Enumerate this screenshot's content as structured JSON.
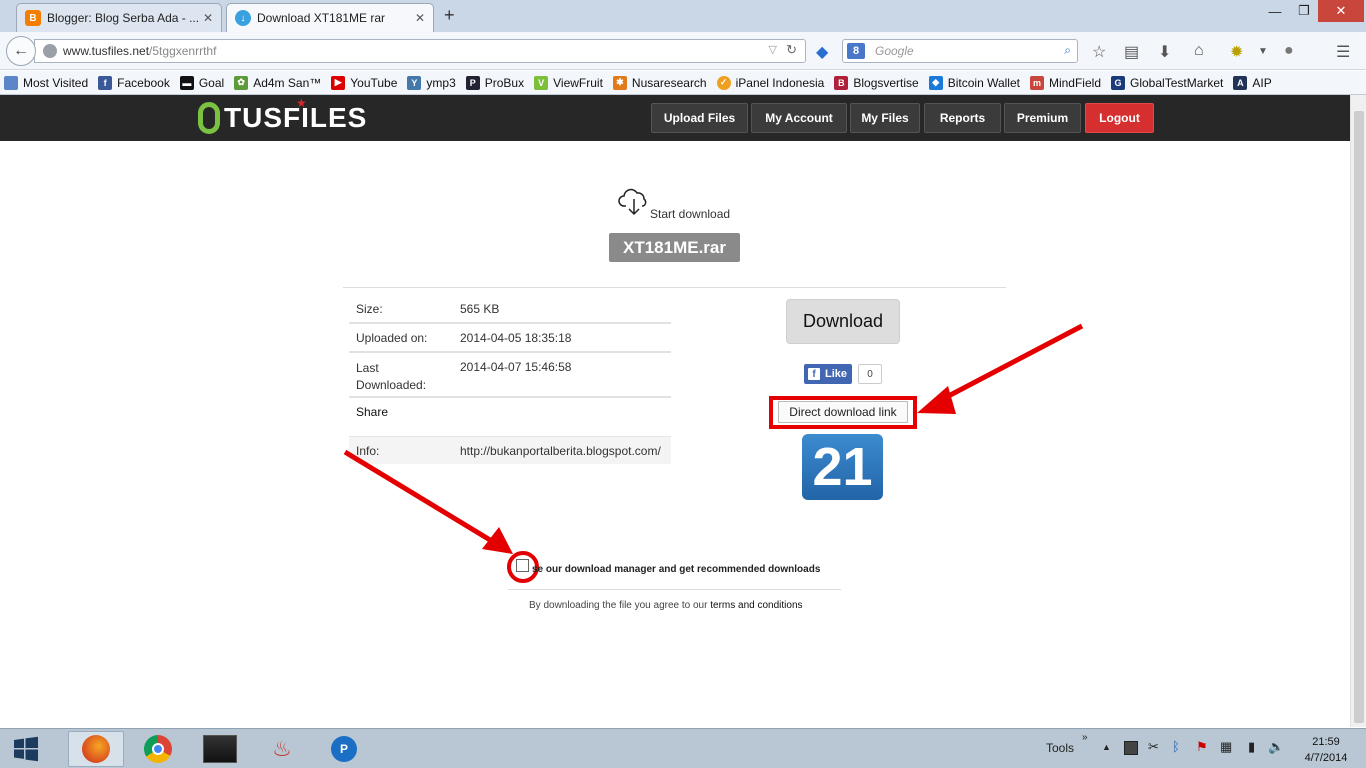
{
  "browser": {
    "tabs": [
      {
        "title": "Blogger: Blog Serba Ada - ...",
        "icon": "blogger-icon"
      },
      {
        "title": "Download XT181ME rar",
        "icon": "download-icon"
      }
    ],
    "url": {
      "host": "www.tusfiles.net",
      "path": "/5tggxenrrthf"
    },
    "search_placeholder": "Google",
    "bookmarks": [
      "Most Visited",
      "Facebook",
      "Goal",
      "Ad4m San™",
      "YouTube",
      "ymp3",
      "ProBux",
      "ViewFruit",
      "Nusaresearch",
      "iPanel Indonesia",
      "Blogsvertise",
      "Bitcoin Wallet",
      "MindField",
      "GlobalTestMarket",
      "AIP"
    ]
  },
  "site": {
    "logo": "TUSFILES",
    "nav": [
      "Upload Files",
      "My Account",
      "My Files",
      "Reports",
      "Premium",
      "Logout"
    ]
  },
  "download": {
    "start_label": "Start download",
    "filename": "XT181ME.rar",
    "rows": [
      {
        "key": "Size:",
        "value": "565 KB"
      },
      {
        "key": "Uploaded on:",
        "value": "2014-04-05 18:35:18"
      },
      {
        "key": "Last Downloaded:",
        "value": "2014-04-07 15:46:58"
      },
      {
        "key": "Share",
        "value": ""
      },
      {
        "key": "Info:",
        "value": "http://bukanportalberita.blogspot.com/"
      }
    ],
    "download_button": "Download",
    "like_label": "Like",
    "like_count": "0",
    "direct_link": "Direct download link",
    "countdown": "21",
    "manager_text": "se our download manager and get recommended downloads",
    "agree_prefix": "By downloading the file you agree to our ",
    "agree_link": "terms and conditions"
  },
  "taskbar": {
    "tools_label": "Tools",
    "time": "21:59",
    "date": "4/7/2014"
  },
  "colors": {
    "accent_red": "#d5302f",
    "logo_green": "#7bc142",
    "counter_blue": "#2a70b5",
    "annotation_red": "#e40000"
  }
}
